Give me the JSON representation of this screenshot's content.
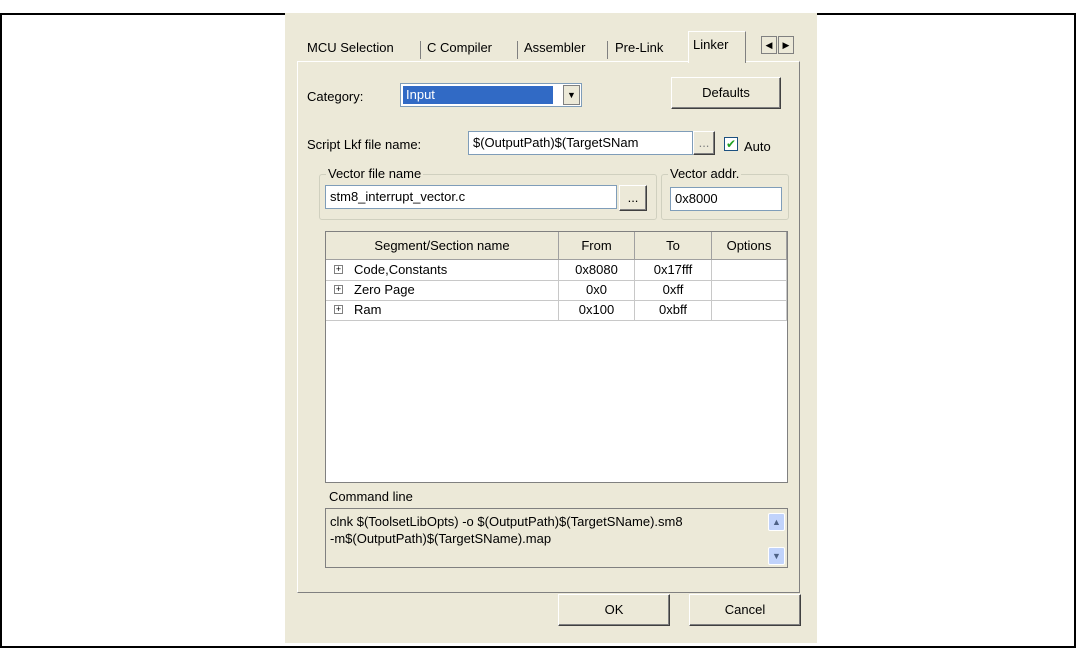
{
  "tabs": [
    "MCU Selection",
    "C Compiler",
    "Assembler",
    "Pre-Link",
    "Linker"
  ],
  "spin_left": "◀",
  "spin_right": "▶",
  "category": {
    "label": "Category:",
    "value": "Input"
  },
  "defaults_label": "Defaults",
  "script": {
    "label": "Script Lkf file name:",
    "value": "$(OutputPath)$(TargetSNam",
    "browse": "...",
    "auto_label": "Auto",
    "auto_checked": true
  },
  "vector_file": {
    "label": "Vector file name",
    "value": "stm8_interrupt_vector.c",
    "browse": "..."
  },
  "vector_addr": {
    "label": "Vector addr.",
    "value": "0x8000"
  },
  "table": {
    "headers": [
      "Segment/Section name",
      "From",
      "To",
      "Options"
    ],
    "rows": [
      {
        "name": "Code,Constants",
        "from": "0x8080",
        "to": "0x17fff",
        "options": ""
      },
      {
        "name": "Zero Page",
        "from": "0x0",
        "to": "0xff",
        "options": ""
      },
      {
        "name": "Ram",
        "from": "0x100",
        "to": "0xbff",
        "options": ""
      }
    ]
  },
  "command": {
    "label": "Command line",
    "line1": "clnk $(ToolsetLibOpts) -o $(OutputPath)$(TargetSName).sm8",
    "line2": "-m$(OutputPath)$(TargetSName).map"
  },
  "ok_label": "OK",
  "cancel_label": "Cancel"
}
